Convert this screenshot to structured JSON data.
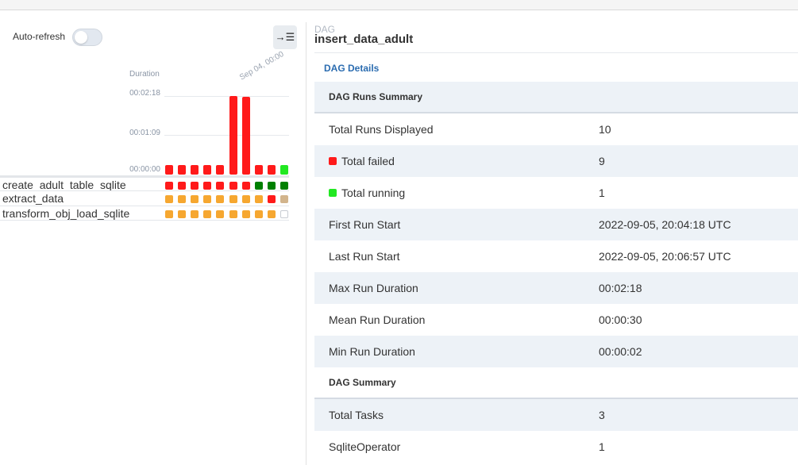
{
  "colors": {
    "failed": "#ff1a1a",
    "running": "#22e822",
    "success": "#008000",
    "queued_upstream": "#f6a730",
    "no_status": "#ffffff",
    "tan": "#d2b48c"
  },
  "left_panel": {
    "auto_refresh_label": "Auto-refresh",
    "auto_refresh_on": false,
    "collapse_icon": "collapse-right-icon",
    "collapse_glyph": "→☰"
  },
  "chart_data": {
    "type": "bar",
    "ylabel": "Duration",
    "y_ticks": [
      "00:00:00",
      "00:01:09",
      "00:02:18"
    ],
    "ylim_seconds": [
      0,
      138
    ],
    "date_label": "Sep 04, 00:00",
    "runs": [
      {
        "duration_seconds": 2,
        "state": "failed"
      },
      {
        "duration_seconds": 2,
        "state": "failed"
      },
      {
        "duration_seconds": 2,
        "state": "failed"
      },
      {
        "duration_seconds": 2,
        "state": "failed"
      },
      {
        "duration_seconds": 2,
        "state": "failed"
      },
      {
        "duration_seconds": 138,
        "state": "failed"
      },
      {
        "duration_seconds": 136,
        "state": "failed"
      },
      {
        "duration_seconds": 2,
        "state": "failed"
      },
      {
        "duration_seconds": 2,
        "state": "failed"
      },
      {
        "duration_seconds": 2,
        "state": "running"
      }
    ]
  },
  "tasks": [
    {
      "name": "create_adult_table_sqlite",
      "states": [
        "failed",
        "failed",
        "failed",
        "failed",
        "failed",
        "failed",
        "failed",
        "success",
        "success",
        "success"
      ]
    },
    {
      "name": "extract_data",
      "states": [
        "queued_upstream",
        "queued_upstream",
        "queued_upstream",
        "queued_upstream",
        "queued_upstream",
        "queued_upstream",
        "queued_upstream",
        "queued_upstream",
        "failed",
        "tan"
      ]
    },
    {
      "name": "transform_obj_load_sqlite",
      "states": [
        "queued_upstream",
        "queued_upstream",
        "queued_upstream",
        "queued_upstream",
        "queued_upstream",
        "queued_upstream",
        "queued_upstream",
        "queued_upstream",
        "queued_upstream",
        "no_status"
      ]
    }
  ],
  "right_panel": {
    "dag_tag": "DAG",
    "dag_name": "insert_data_adult",
    "details_link": "DAG Details",
    "runs_summary_header": "DAG Runs Summary",
    "runs_summary": [
      {
        "key": "Total Runs Displayed",
        "value": "10"
      },
      {
        "key": "Total failed",
        "value": "9",
        "swatch": "#ff1a1a"
      },
      {
        "key": "Total running",
        "value": "1",
        "swatch": "#22e822"
      },
      {
        "key": "First Run Start",
        "value": "2022-09-05, 20:04:18 UTC"
      },
      {
        "key": "Last Run Start",
        "value": "2022-09-05, 20:06:57 UTC"
      },
      {
        "key": "Max Run Duration",
        "value": "00:02:18"
      },
      {
        "key": "Mean Run Duration",
        "value": "00:00:30"
      },
      {
        "key": "Min Run Duration",
        "value": "00:00:02"
      }
    ],
    "dag_summary_header": "DAG Summary",
    "dag_summary": [
      {
        "key": "Total Tasks",
        "value": "3"
      },
      {
        "key": "SqliteOperator",
        "value": "1"
      }
    ]
  }
}
